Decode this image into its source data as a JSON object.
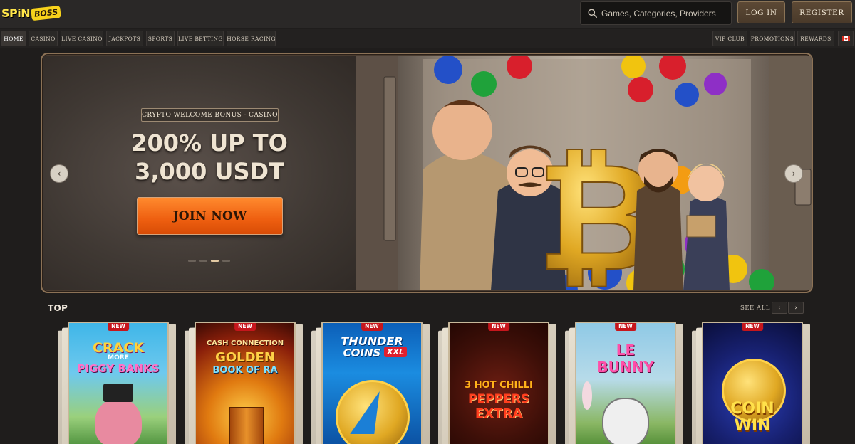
{
  "brand": {
    "logo_word_1": "SPiN",
    "logo_word_2": "BOSS"
  },
  "search": {
    "placeholder": "Games, Categories, Providers"
  },
  "header": {
    "login_label": "LOG IN",
    "register_label": "REGISTER"
  },
  "nav": {
    "items": [
      {
        "label": "HOME",
        "active": true
      },
      {
        "label": "CASINO"
      },
      {
        "label": "LIVE CASINO"
      },
      {
        "label": "JACKPOTS"
      },
      {
        "label": "SPORTS"
      },
      {
        "label": "LIVE BETTING"
      },
      {
        "label": "HORSE RACING"
      }
    ],
    "right_items": [
      {
        "label": "VIP CLUB"
      },
      {
        "label": "PROMOTIONS"
      },
      {
        "label": "REWARDS"
      }
    ],
    "flag_icon": "canada-flag-icon"
  },
  "hero": {
    "tag": "CRYPTO WELCOME BONUS - CASINO",
    "title_line_1": "200% UP TO",
    "title_line_2": "3,000 USDT",
    "cta_label": "JOIN NOW",
    "slide_count": 4,
    "active_slide": 3,
    "prev_icon": "chevron-left-icon",
    "next_icon": "chevron-right-icon",
    "art_text": "₿"
  },
  "top_games": {
    "title": "TOP",
    "see_all_label": "SEE ALL",
    "badge_label": "NEW",
    "games": [
      {
        "line_1": "CRACK",
        "line_2": "MORE",
        "line_3": "PIGGY BANKS"
      },
      {
        "line_1": "CASH CONNECTION",
        "line_2": "GOLDEN",
        "line_3": "BOOK OF RA"
      },
      {
        "line_1": "THUNDER",
        "line_2": "COINS",
        "line_3": "XXL"
      },
      {
        "line_1": "3 HOT CHILLI",
        "line_2": "PEPPERS",
        "line_3": "EXTRA"
      },
      {
        "line_1": "LE",
        "line_2": "BUNNY",
        "line_3": ""
      },
      {
        "line_1": "COIN",
        "line_2": "WIN",
        "line_3": ""
      }
    ]
  },
  "colors": {
    "background": "#1f1d1c",
    "accent_orange": "#ee5f10",
    "gold_border": "#8c7256",
    "new_badge": "#c6161c"
  }
}
